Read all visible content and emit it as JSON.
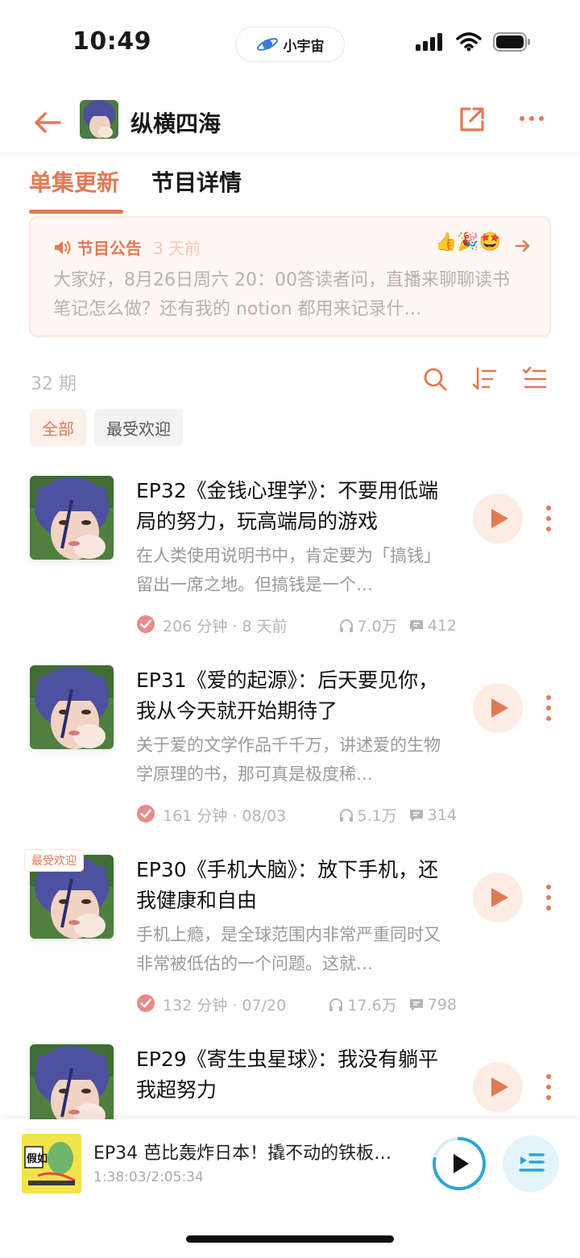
{
  "status": {
    "time": "10:49",
    "app_pill": "小宇宙"
  },
  "header": {
    "title": "纵横四海"
  },
  "tabs": [
    {
      "label": "单集更新"
    },
    {
      "label": "节目详情"
    }
  ],
  "announcement": {
    "label": "节目公告",
    "time": "3 天前",
    "emoji": "👍🎉🤩",
    "text": "大家好，8月26日周六 20：00答读者问，直播来聊聊读书笔记怎么做？还有我的 notion 都用来记录什…"
  },
  "list": {
    "count": "32 期"
  },
  "filters": [
    {
      "label": "全部"
    },
    {
      "label": "最受欢迎"
    }
  ],
  "episodes": [
    {
      "title": "EP32《金钱心理学》：不要用低端局的努力，玩高端局的游戏",
      "desc": "在人类使用说明书中，肯定要为「搞钱」留出一席之地。但搞钱是一个…",
      "duration": "206 分钟 · 8 天前",
      "plays": "7.0万",
      "comments": "412",
      "badge": ""
    },
    {
      "title": "EP31《爱的起源》：后天要见你，我从今天就开始期待了",
      "desc": "关于爱的文学作品千千万，讲述爱的生物学原理的书，那可真是极度稀…",
      "duration": "161 分钟 · 08/03",
      "plays": "5.1万",
      "comments": "314",
      "badge": ""
    },
    {
      "title": "EP30《手机大脑》：放下手机，还我健康和自由",
      "desc": "手机上瘾，是全球范围内非常严重同时又非常被低估的一个问题。这就…",
      "duration": "132 分钟 · 07/20",
      "plays": "17.6万",
      "comments": "798",
      "badge": "最受欢迎"
    },
    {
      "title": "EP29《寄生虫星球》：我没有躺平我超努力",
      "desc": "",
      "duration": "",
      "plays": "",
      "comments": "",
      "badge": ""
    }
  ],
  "player": {
    "title": "EP34 芭比轰炸日本！撬不动的铁板…",
    "time": "1:38:03/2:05:34",
    "cover_text": "假如"
  },
  "colors": {
    "accent": "#e07a55",
    "player_accent": "#2ba6d6"
  }
}
